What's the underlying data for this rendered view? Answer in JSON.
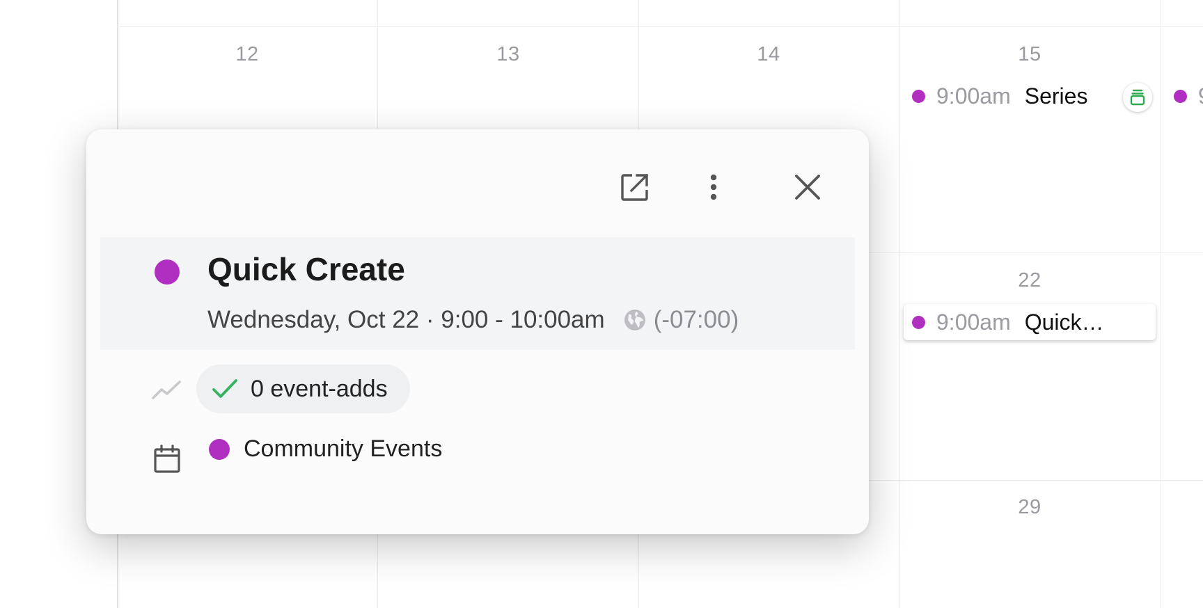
{
  "calendar": {
    "day_numbers": [
      "12",
      "13",
      "14",
      "15",
      "22",
      "29"
    ],
    "events": [
      {
        "time": "9:00am",
        "title": "Series"
      },
      {
        "time": "9:00am",
        "title": "Quick…"
      }
    ],
    "partial_event_time": "9"
  },
  "popover": {
    "title": "Quick Create",
    "when": "Wednesday, Oct 22 · 9:00 - 10:00am",
    "timezone": "(-07:00)",
    "event_adds": "0 event-adds",
    "calendar_name": "Community Events",
    "actions": {
      "open_icon": "open-external-icon",
      "more_icon": "more-vertical-icon",
      "close_icon": "close-icon"
    }
  },
  "colors": {
    "event_purple": "#b02ec0",
    "check_green": "#35b35f",
    "series_green": "#2fa84f",
    "header_band": "#f3f4f6"
  }
}
